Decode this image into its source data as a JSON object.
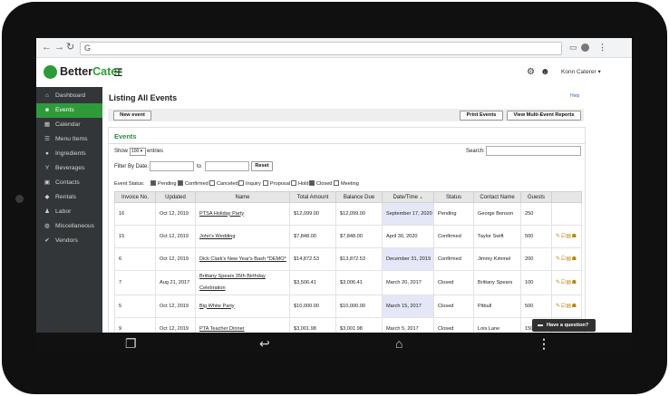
{
  "brand": {
    "name_part1": "Better",
    "name_part2": "Cater"
  },
  "browser": {
    "omnibox_icon": "G",
    "back_icon": "←",
    "forward_icon": "→",
    "reload_icon": "↻"
  },
  "header": {
    "user_menu": "Konn Caterer ▾"
  },
  "sidebar": {
    "items": [
      {
        "label": "Dashboard",
        "icon": "home-icon",
        "glyph": "⌂",
        "active": false
      },
      {
        "label": "Events",
        "icon": "bookmark-icon",
        "glyph": "■",
        "active": true
      },
      {
        "label": "Calendar",
        "icon": "calendar-icon",
        "glyph": "▦",
        "active": false
      },
      {
        "label": "Menu Items",
        "icon": "list-icon",
        "glyph": "☰",
        "active": false
      },
      {
        "label": "Ingredients",
        "icon": "apple-icon",
        "glyph": "●",
        "active": false
      },
      {
        "label": "Beverages",
        "icon": "glass-icon",
        "glyph": "Y",
        "active": false
      },
      {
        "label": "Contacts",
        "icon": "contact-card-icon",
        "glyph": "▣",
        "active": false
      },
      {
        "label": "Rentals",
        "icon": "tag-icon",
        "glyph": "◆",
        "active": false
      },
      {
        "label": "Labor",
        "icon": "person-icon",
        "glyph": "♟",
        "active": false
      },
      {
        "label": "Miscellaneous",
        "icon": "globe-icon",
        "glyph": "◍",
        "active": false
      },
      {
        "label": "Vendors",
        "icon": "check-icon",
        "glyph": "✔",
        "active": false
      }
    ]
  },
  "main": {
    "title": "Listing All Events",
    "help": "Help",
    "new_event": "New event",
    "print_events": "Print Events",
    "multi_report": "View Multi-Event Reports"
  },
  "panel": {
    "title": "Events",
    "show": "Show",
    "entries_value": "100",
    "entries": "entries",
    "search_label": "Search:",
    "filter_label": "Filter By Date:",
    "to_label": "to",
    "reset": "Reset",
    "status_label": "Event Status:",
    "statuses": [
      {
        "label": "Pending",
        "checked": true
      },
      {
        "label": "Confirmed",
        "checked": true
      },
      {
        "label": "Canceled",
        "checked": false
      },
      {
        "label": "Inquiry",
        "checked": false
      },
      {
        "label": "Proposal",
        "checked": false
      },
      {
        "label": "Hold",
        "checked": false
      },
      {
        "label": "Closed",
        "checked": true
      },
      {
        "label": "Meeting",
        "checked": false
      }
    ]
  },
  "table": {
    "headers": [
      "Invoice No.",
      "Updated",
      "Name",
      "Total Amount",
      "Balance Due",
      "Date/Time",
      "Status",
      "Contact Name",
      "Guests",
      ""
    ],
    "rows": [
      {
        "invoice": "16",
        "updated": "Oct 12, 2019",
        "name": "PTSA Holiday Party",
        "total": "$12,099.00",
        "balance": "$12,099.00",
        "date": "September 17, 2020",
        "status": "Pending",
        "contact": "George Benson",
        "guests": "250"
      },
      {
        "invoice": "15",
        "updated": "Oct 12, 2019",
        "name": "John's Wedding",
        "total": "$7,848.00",
        "balance": "$7,848.00",
        "date": "April 30, 2020",
        "status": "Confirmed",
        "contact": "Taylor Swift",
        "guests": "500"
      },
      {
        "invoice": "6",
        "updated": "Oct 12, 2019",
        "name": "Dick Clark's New Year's Bash *DEMO*",
        "total": "$14,872.53",
        "balance": "$13,872.53",
        "date": "December 31, 2019",
        "status": "Confirmed",
        "contact": "Jimmy Kimmel",
        "guests": "200"
      },
      {
        "invoice": "7",
        "updated": "Aug 21, 2017",
        "name": "Brittany Spears 35th Birthday Celebration",
        "total": "$3,506.41",
        "balance": "$3,006.41",
        "date": "March 20, 2017",
        "status": "Closed",
        "contact": "Brittany Spears",
        "guests": "100"
      },
      {
        "invoice": "5",
        "updated": "Oct 12, 2019",
        "name": "Big White Party",
        "total": "$10,000.00",
        "balance": "$10,000.00",
        "date": "March 15, 2017",
        "status": "Closed",
        "contact": "Pitbull",
        "guests": "500"
      },
      {
        "invoice": "9",
        "updated": "Oct 12, 2019",
        "name": "PTA Teacher Dinner",
        "total": "$3,001.98",
        "balance": "$3,001.98",
        "date": "March 5, 2017",
        "status": "Closed",
        "contact": "Lois Lane",
        "guests": "150"
      }
    ]
  },
  "chat": {
    "label": "Have a question?"
  }
}
